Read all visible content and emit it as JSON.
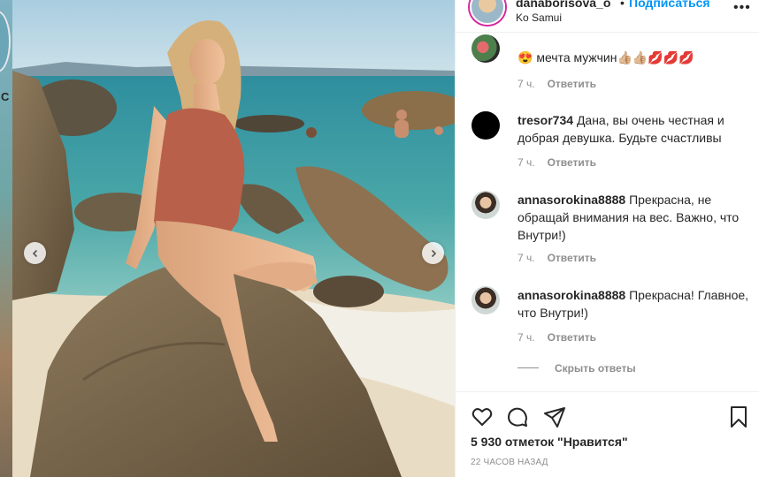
{
  "header": {
    "username": "danaborisova_o",
    "separator": "•",
    "follow_label": "Подписаться",
    "location": "Ko Samui",
    "more_icon": "ellipsis-icon"
  },
  "backdrop": {
    "letter": "C"
  },
  "comments": [
    {
      "username": "",
      "text": "😍 мечта мужчин👍🏼👍🏼💋💋💋",
      "time": "7 ч.",
      "reply_label": "Ответить"
    },
    {
      "username": "tresor734",
      "text": "Дана, вы очень честная и добрая девушка. Будьте счастливы",
      "time": "7 ч.",
      "reply_label": "Ответить"
    },
    {
      "username": "annasorokina8888",
      "text": "Прекрасна, не обращай внимания на вес. Важно, что Внутри!)",
      "time": "7 ч.",
      "reply_label": "Ответить"
    },
    {
      "username": "annasorokina8888",
      "text": "Прекрасна! Главное, что Внутри!)",
      "time": "7 ч.",
      "reply_label": "Ответить"
    }
  ],
  "hide_replies_label": "Скрыть ответы",
  "actions": {
    "like_icon": "heart-icon",
    "comment_icon": "comment-icon",
    "share_icon": "share-icon",
    "save_icon": "bookmark-icon"
  },
  "likes_text": "5 930 отметок \"Нравится\"",
  "time_ago": "22 ЧАСОВ НАЗАД",
  "colors": {
    "follow": "#0095f6",
    "text": "#262626",
    "muted": "#8e8e8e"
  }
}
